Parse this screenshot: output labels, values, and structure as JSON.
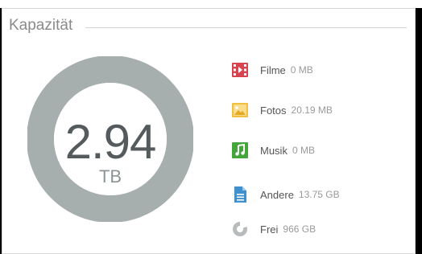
{
  "panel": {
    "title": "Kapazität"
  },
  "capacity": {
    "value": "2.94",
    "unit": "TB",
    "ring_color": "#a7aeae"
  },
  "legend": [
    {
      "icon": "film-icon",
      "label": "Filme",
      "amount": "0 MB",
      "color": "#d9434f"
    },
    {
      "icon": "photo-icon",
      "label": "Fotos",
      "amount": "20.19 MB",
      "color": "#f1bf3e"
    },
    {
      "icon": "music-icon",
      "label": "Musik",
      "amount": "0 MB",
      "color": "#43a53a"
    },
    {
      "icon": "document-icon",
      "label": "Andere",
      "amount": "13.75 GB",
      "color": "#3f90cf"
    },
    {
      "icon": "pie-icon",
      "label": "Frei",
      "amount": "966 GB",
      "color": "#b7bbbc"
    }
  ]
}
